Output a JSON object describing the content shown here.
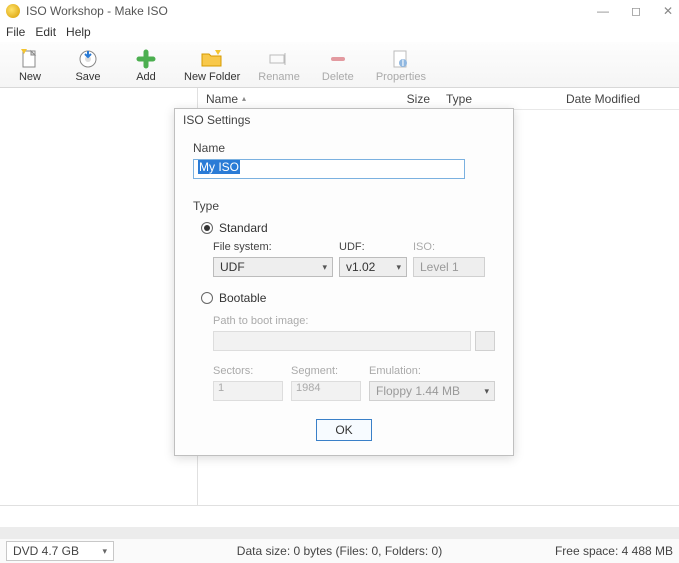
{
  "window": {
    "title": "ISO Workshop - Make ISO"
  },
  "menu": {
    "file": "File",
    "edit": "Edit",
    "help": "Help"
  },
  "toolbar": {
    "new": "New",
    "save": "Save",
    "add": "Add",
    "newfolder": "New Folder",
    "rename": "Rename",
    "delete": "Delete",
    "properties": "Properties"
  },
  "columns": {
    "name": "Name",
    "size": "Size",
    "type": "Type",
    "date": "Date Modified"
  },
  "status": {
    "media": "DVD 4.7 GB",
    "data": "Data size: 0 bytes (Files: 0, Folders: 0)",
    "free": "Free space: 4 488 MB"
  },
  "dialog": {
    "title": "ISO Settings",
    "name_label": "Name",
    "name_value": "My ISO",
    "type_label": "Type",
    "standard_label": "Standard",
    "bootable_label": "Bootable",
    "fs_label": "File system:",
    "fs_value": "UDF",
    "udf_label": "UDF:",
    "udf_value": "v1.02",
    "iso_label": "ISO:",
    "iso_value": "Level 1",
    "path_label": "Path to boot image:",
    "sectors_label": "Sectors:",
    "sectors_value": "1",
    "segment_label": "Segment:",
    "segment_value": "1984",
    "emulation_label": "Emulation:",
    "emulation_value": "Floppy 1.44 MB",
    "ok": "OK"
  }
}
